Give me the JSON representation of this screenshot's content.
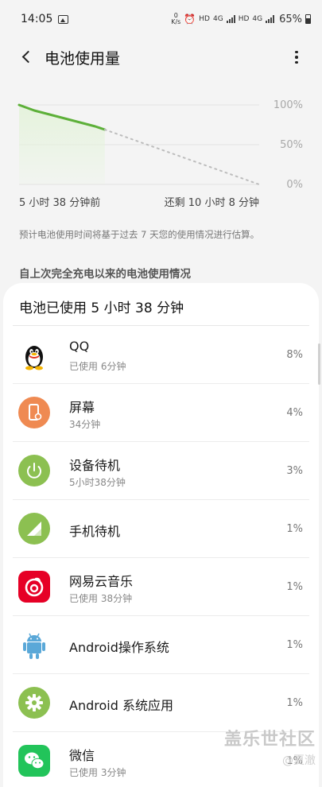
{
  "status_bar": {
    "time": "14:05",
    "speed_value": "0",
    "speed_unit": "K/s",
    "hd1": "HD",
    "net1": "4G",
    "hd2": "HD",
    "net2": "4G",
    "battery": "65%"
  },
  "app_bar": {
    "title": "电池使用量"
  },
  "chart_data": {
    "type": "area",
    "y_ticks": [
      "100%",
      "50%",
      "0%"
    ],
    "ylim": [
      0,
      100
    ],
    "x_start_label": "5 小时 38 分钟前",
    "x_end_label": "还剩 10 小时 8 分钟",
    "series": [
      {
        "style": "actual",
        "x_hours": [
          0,
          1,
          2,
          3,
          4,
          5,
          5.63
        ],
        "values": [
          100,
          93,
          88,
          83,
          78,
          73,
          69
        ]
      },
      {
        "style": "projected",
        "x_hours": [
          5.63,
          15.77
        ],
        "values": [
          69,
          0
        ]
      }
    ],
    "x_total_hours": 15.77,
    "colors": {
      "line": "#5db039",
      "fill": "#e5f3dc",
      "projection": "#bdbdbd",
      "grid": "#e2e2e2"
    }
  },
  "note": "预计电池使用时间将基于过去 7 天您的使用情况进行估算。",
  "section_title": "自上次完全充电以来的电池使用情况",
  "card_title": "电池已使用 5 小时 38 分钟",
  "apps": [
    {
      "name": "QQ",
      "sub": "已使用 6分钟",
      "percent": "8%",
      "icon": "qq-penguin-icon"
    },
    {
      "name": "屏幕",
      "sub": "34分钟",
      "percent": "4%",
      "icon": "screen-icon"
    },
    {
      "name": "设备待机",
      "sub": "5小时38分钟",
      "percent": "3%",
      "icon": "power-standby-icon"
    },
    {
      "name": "手机待机",
      "sub": "",
      "percent": "1%",
      "icon": "cell-signal-icon"
    },
    {
      "name": "网易云音乐",
      "sub": "已使用 38分钟",
      "percent": "1%",
      "icon": "netease-music-icon"
    },
    {
      "name": "Android操作系统",
      "sub": "",
      "percent": "1%",
      "icon": "android-robot-icon"
    },
    {
      "name": "Android 系统应用",
      "sub": "",
      "percent": "1%",
      "icon": "settings-gear-icon"
    },
    {
      "name": "微信",
      "sub": "已使用 3分钟",
      "percent": "1%",
      "icon": "wechat-icon"
    }
  ],
  "watermark": {
    "brand": "盖乐世社区",
    "user": "@夏澈"
  }
}
